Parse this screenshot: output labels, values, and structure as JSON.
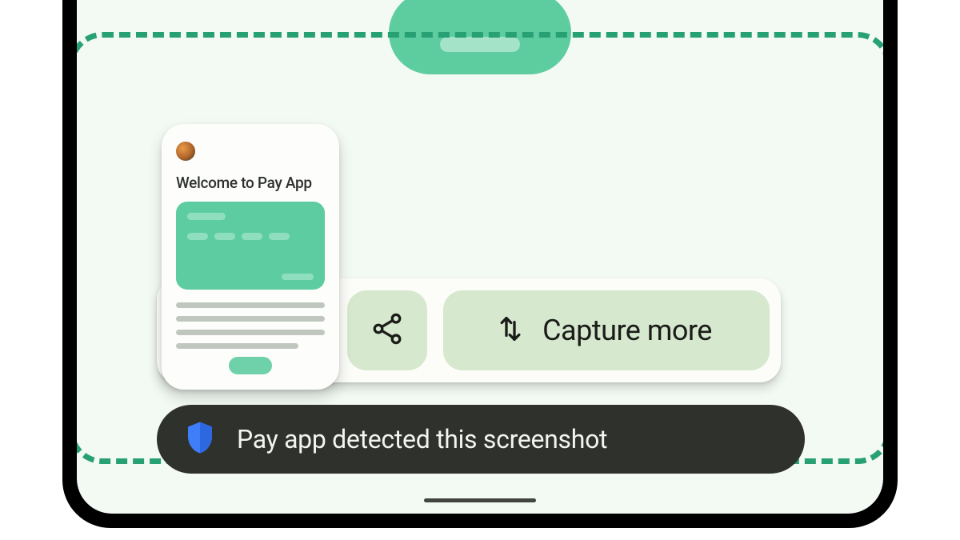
{
  "colors": {
    "accent": "#5dcda0",
    "accent_light": "#a4e3c8",
    "button_bg": "#d6e8cd",
    "snackbar_bg": "#2f312d",
    "highlight_border": "#27a074",
    "shield": "#3e7ef9"
  },
  "pill": {
    "description": "App preview pill indicator"
  },
  "thumbnail": {
    "title": "Welcome to Pay App"
  },
  "actions": {
    "share_label": "Share",
    "capture_more_label": "Capture more"
  },
  "snackbar": {
    "message": "Pay app detected this screenshot"
  }
}
